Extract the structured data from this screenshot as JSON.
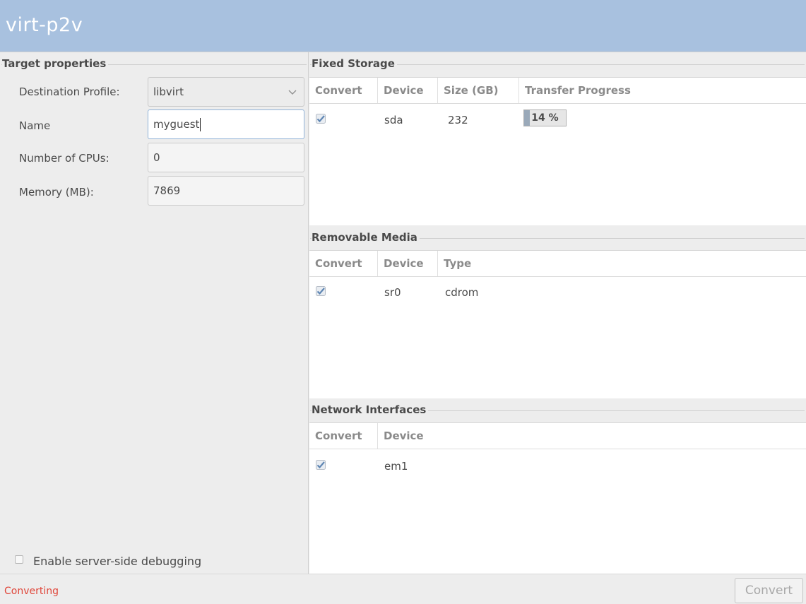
{
  "window": {
    "title": "virt-p2v"
  },
  "target_properties": {
    "heading": "Target properties",
    "destination_profile": {
      "label": "Destination Profile:",
      "value": "libvirt"
    },
    "name": {
      "label": "Name",
      "value": "myguest"
    },
    "cpus": {
      "label": "Number of CPUs:",
      "value": "0"
    },
    "memory": {
      "label": "Memory (MB):",
      "value": "7869"
    },
    "debug": {
      "label": "Enable server-side debugging",
      "checked": false
    }
  },
  "fixed_storage": {
    "heading": "Fixed Storage",
    "columns": [
      "Convert",
      "Device",
      "Size (GB)",
      "Transfer Progress"
    ],
    "rows": [
      {
        "convert": true,
        "device": "sda",
        "size": "232",
        "progress_text": "14 %",
        "progress": 0.14
      }
    ]
  },
  "removable_media": {
    "heading": "Removable Media",
    "columns": [
      "Convert",
      "Device",
      "Type"
    ],
    "rows": [
      {
        "convert": true,
        "device": "sr0",
        "type": "cdrom"
      }
    ]
  },
  "network_interfaces": {
    "heading": "Network Interfaces",
    "columns": [
      "Convert",
      "Device"
    ],
    "rows": [
      {
        "convert": true,
        "device": "em1"
      }
    ]
  },
  "status": {
    "text": "Converting"
  },
  "actions": {
    "convert_label": "Convert"
  },
  "icons": {
    "check": "checkmark-icon",
    "dropdown": "chevron-down-icon"
  },
  "colors": {
    "titlebar": "#a8c1df",
    "status_text": "#e0463a"
  }
}
